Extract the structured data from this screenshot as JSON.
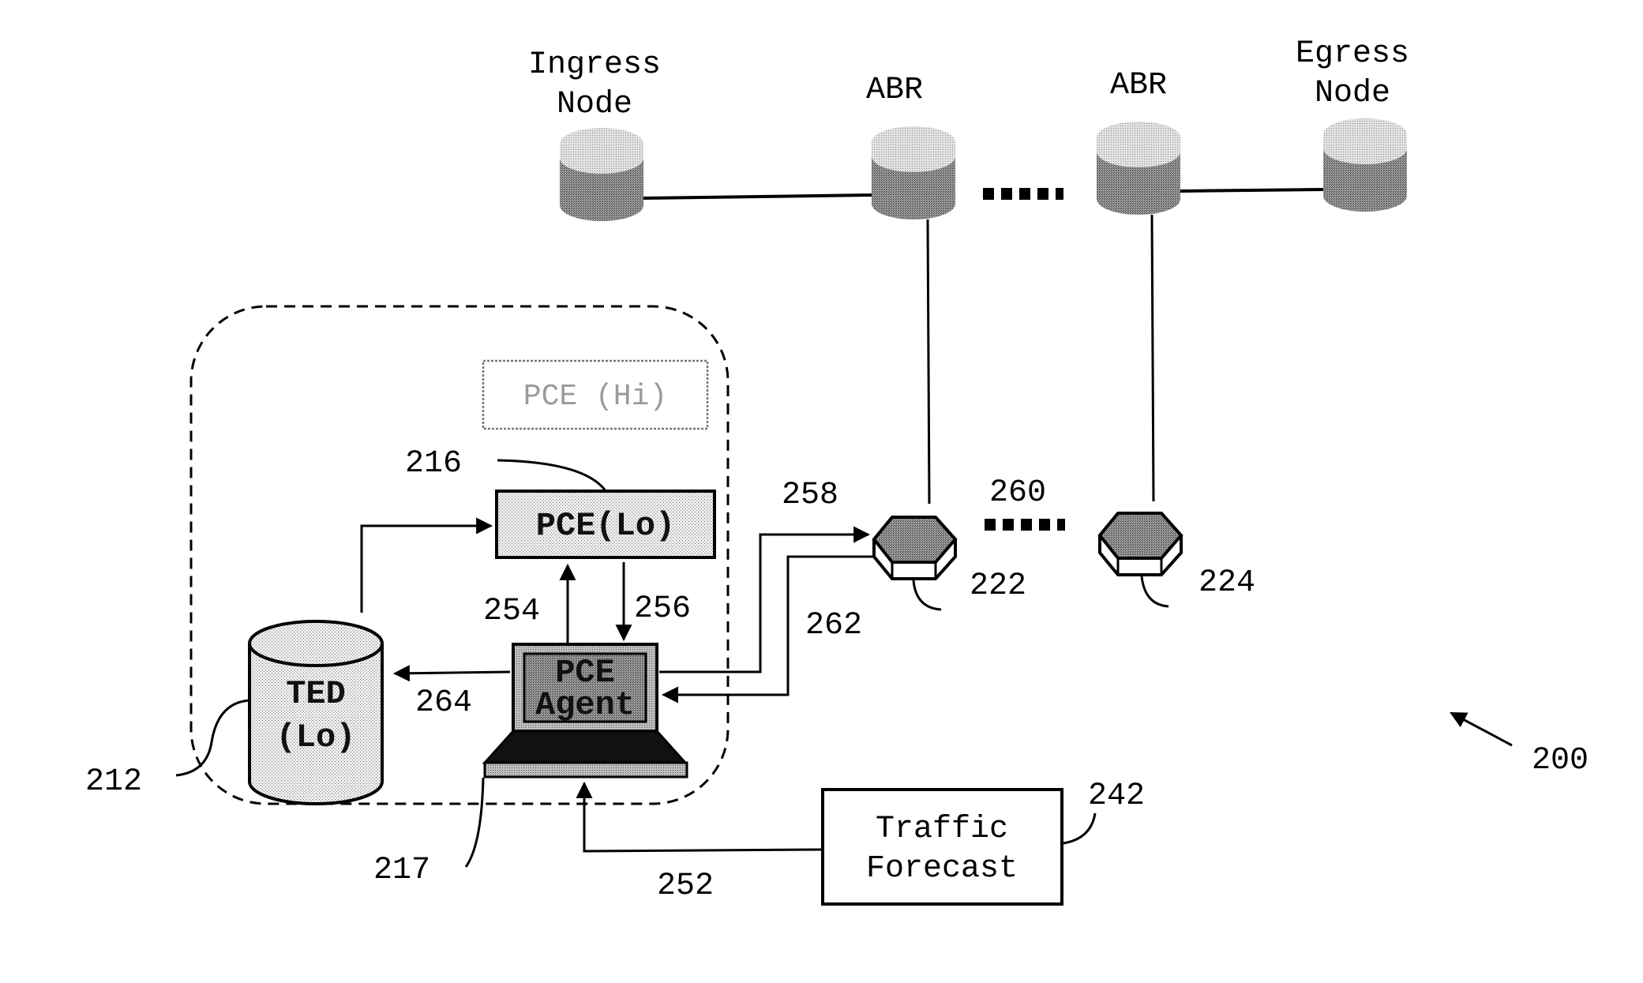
{
  "figure_ref": "200",
  "network": {
    "nodes": [
      {
        "id": "ingress",
        "label_line1": "Ingress",
        "label_line2": "Node"
      },
      {
        "id": "abr1",
        "label_line1": "ABR",
        "label_line2": ""
      },
      {
        "id": "abr2",
        "label_line1": "ABR",
        "label_line2": ""
      },
      {
        "id": "egress",
        "label_line1": "Egress",
        "label_line2": "Node"
      }
    ],
    "ellipsis": "....."
  },
  "domain_box": {
    "pce_hi": "PCE (Hi)",
    "pce_lo": "PCE(Lo)",
    "ted_line1": "TED",
    "ted_line2": "(Lo)",
    "agent_line1": "PCE",
    "agent_line2": "Agent"
  },
  "traffic_forecast": {
    "line1": "Traffic",
    "line2": "Forecast"
  },
  "refs": {
    "r212": "212",
    "r216": "216",
    "r217": "217",
    "r222": "222",
    "r224": "224",
    "r242": "242",
    "r252": "252",
    "r254": "254",
    "r256": "256",
    "r258": "258",
    "r260": "260",
    "r262": "262",
    "r264": "264",
    "r200": "200"
  }
}
